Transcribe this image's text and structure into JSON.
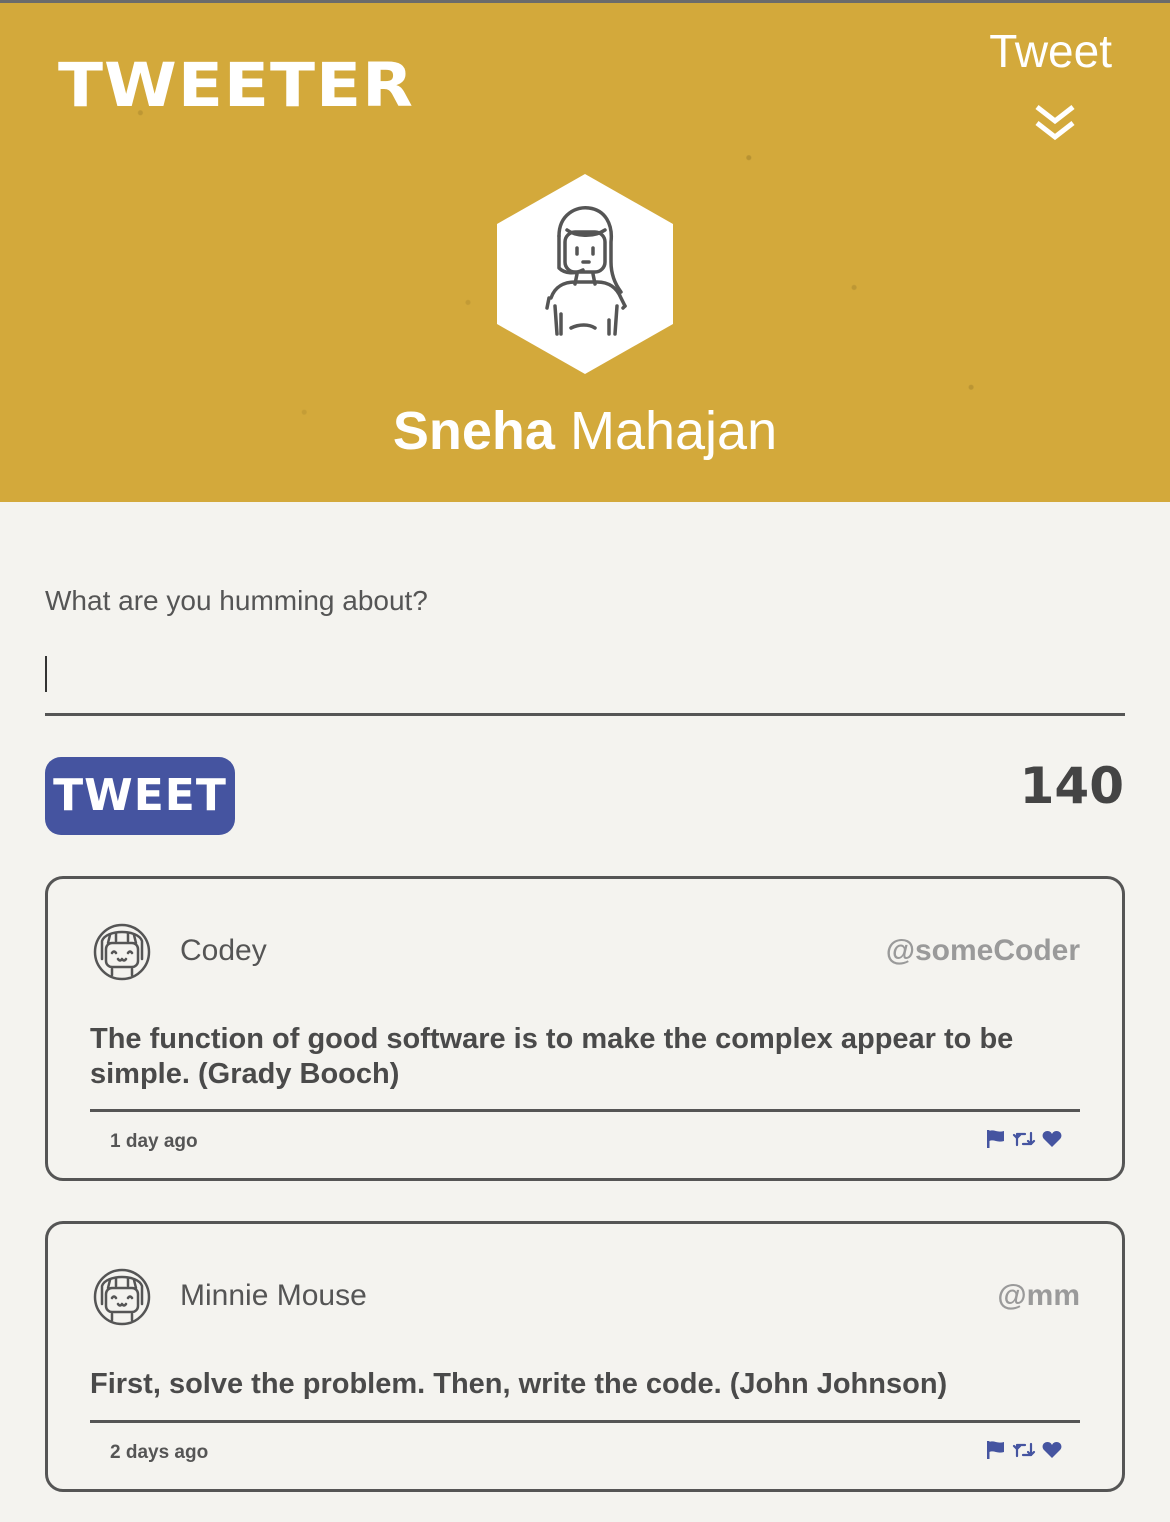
{
  "header": {
    "logo": "TWEETER",
    "nav_tweet_label": "Tweet",
    "nav_arrow_icon": "double-chevron-down-icon",
    "avatar_icon": "woman-portrait-icon",
    "user_first": "Sneha",
    "user_last": "Mahajan"
  },
  "composer": {
    "label": "What are you humming about?",
    "placeholder": "",
    "value": "",
    "button_label": "TWEET",
    "counter": "140"
  },
  "tweets": [
    {
      "avatar_icon": "girl-face-icon",
      "name": "Codey",
      "handle": "@someCoder",
      "text": "The function of good software is to make the complex appear to be simple. (Grady Booch)",
      "time": "1 day ago",
      "actions": [
        "flag-icon",
        "retweet-icon",
        "heart-icon"
      ]
    },
    {
      "avatar_icon": "girl-face-icon",
      "name": "Minnie Mouse",
      "handle": "@mm",
      "text": "First, solve the problem. Then, write the code. (John Johnson)",
      "time": "2 days ago",
      "actions": [
        "flag-icon",
        "retweet-icon",
        "heart-icon"
      ]
    }
  ],
  "colors": {
    "header_bg": "#d3a93b",
    "accent_blue": "#4554a0",
    "text_dark": "#4a4a4a",
    "page_bg": "#f4f3ef"
  }
}
